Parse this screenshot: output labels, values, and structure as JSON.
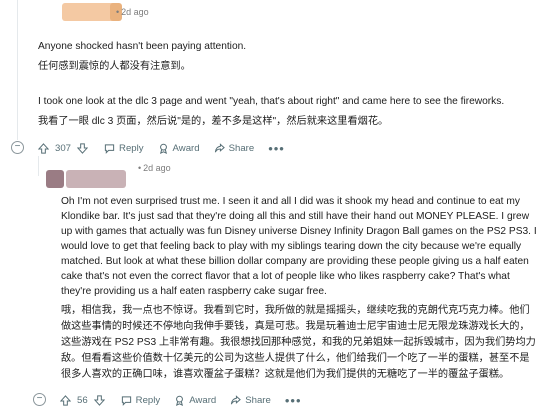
{
  "comment1": {
    "time": "2d ago",
    "lines": [
      "Anyone shocked hasn't been paying attention.",
      "任何感到震惊的人都没有注意到。",
      "I took one look at the dlc 3 page and went \"yeah, that's about right\" and came here to see the fireworks.",
      "我看了一眼 dlc 3 页面，然后说\"是的，差不多是这样\"，然后就来这里看烟花。"
    ],
    "votes": "307",
    "reply_label": "Reply",
    "award_label": "Award",
    "share_label": "Share"
  },
  "comment2": {
    "time": "2d ago",
    "english": [
      "Oh I'm not even surprised trust me. I seen it and all I did was it shook my head and continue to eat my",
      "Klondike bar. It's just sad that they're doing all this and still have their hand out MONEY PLEASE. I grew",
      "up with games that actually was fun Disney universe Disney Infinity Dragon Ball games on the PS2 PS3. I",
      "would love to get that feeling back to play with my siblings tearing down the city because we're equally",
      "matched. But look at what these billion dollar company are providing these people giving us a half eaten",
      "cake that's not even the correct flavor that a lot of people like who likes raspberry cake? That's what",
      "they're providing us a half eaten raspberry cake sugar free."
    ],
    "chinese": [
      "哦，相信我，我一点也不惊讶。我看到它时，我所做的就是摇摇头，继续吃我的克朗代克巧克力棒。他们",
      "做这些事情的时候还不停地向我伸手要钱，真是可悲。我是玩着迪士尼宇宙迪士尼无限龙珠游戏长大的，",
      "这些游戏在 PS2 PS3 上非常有趣。我很想找回那种感觉，和我的兄弟姐妹一起拆毁城市，因为我们势均力",
      "敌。但看看这些价值数十亿美元的公司为这些人提供了什么，他们给我们一个吃了一半的蛋糕，甚至不是",
      "很多人喜欢的正确口味，谁喜欢覆盆子蛋糕？这就是他们为我们提供的无糖吃了一半的覆盆子蛋糕。"
    ],
    "votes": "56",
    "reply_label": "Reply",
    "award_label": "Award",
    "share_label": "Share"
  },
  "icons": {
    "upvote": "arrow-up-icon",
    "downvote": "arrow-down-icon",
    "reply": "speech-bubble-icon",
    "award": "award-icon",
    "share": "share-icon",
    "more": "ellipsis-icon",
    "collapse": "collapse-minus-icon"
  },
  "colors": {
    "action_text": "#576f76",
    "avatar1": "#f0b98a",
    "avatar2": "#a88c92"
  }
}
